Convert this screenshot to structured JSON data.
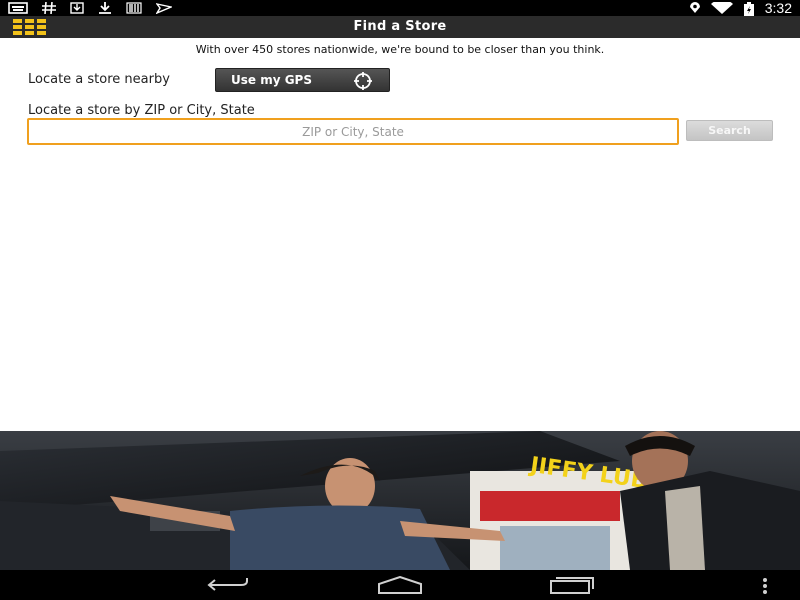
{
  "status_bar": {
    "icons": [
      "keyboard-icon",
      "hash-icon",
      "download-box-icon",
      "download-icon",
      "barcode-icon",
      "plane-icon"
    ],
    "right_icons": [
      "location-icon",
      "wifi-icon",
      "battery-icon"
    ],
    "time": "3:32"
  },
  "title_bar": {
    "title": "Find a Store",
    "menu_icon": "grid-menu-icon",
    "accent_color": "#f2c21a"
  },
  "content": {
    "tagline": "With over 450 stores nationwide, we're bound to be closer than you think.",
    "nearby_label": "Locate a store nearby",
    "gps_button_label": "Use my GPS",
    "zip_label": "Locate a store by ZIP or City, State",
    "zip_input_placeholder": "ZIP or City, State",
    "zip_input_value": "",
    "search_button_label": "Search",
    "input_focus_color": "#f0a01e"
  },
  "promo_image": {
    "sign_text": "JIFFY LUBE PLUS"
  },
  "nav_bar": {
    "buttons": [
      "back-icon",
      "home-icon",
      "recent-apps-icon",
      "overflow-menu-icon"
    ]
  }
}
